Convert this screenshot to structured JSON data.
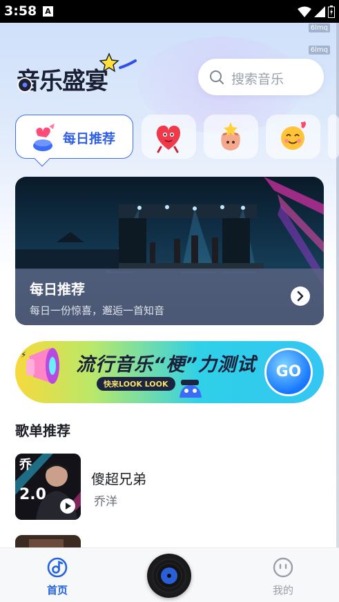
{
  "status_bar": {
    "time": "3:58",
    "notif_letter": "A"
  },
  "watermark": {
    "top": "6lmq",
    "bottom": "6lmq"
  },
  "logo": {
    "text": "音乐盛宴"
  },
  "search": {
    "placeholder": "搜索音乐"
  },
  "categories": {
    "active_label": "每日推荐"
  },
  "banner": {
    "title": "每日推荐",
    "subtitle": "每日一份惊喜，邂逅一首知音"
  },
  "promo": {
    "title": "流行音乐“梗”力测试",
    "pill": "快来LOOK LOOK",
    "go": "GO"
  },
  "playlist": {
    "section_title": "歌单推荐",
    "items": [
      {
        "title": "傻超兄弟",
        "artist": "乔洋"
      }
    ]
  },
  "bottom_nav": {
    "home_label": "首页",
    "mine_label": "我的"
  },
  "colors": {
    "accent": "#2f5fe8",
    "nav_active": "#2362e0",
    "nav_inactive": "#9a9ea6"
  }
}
